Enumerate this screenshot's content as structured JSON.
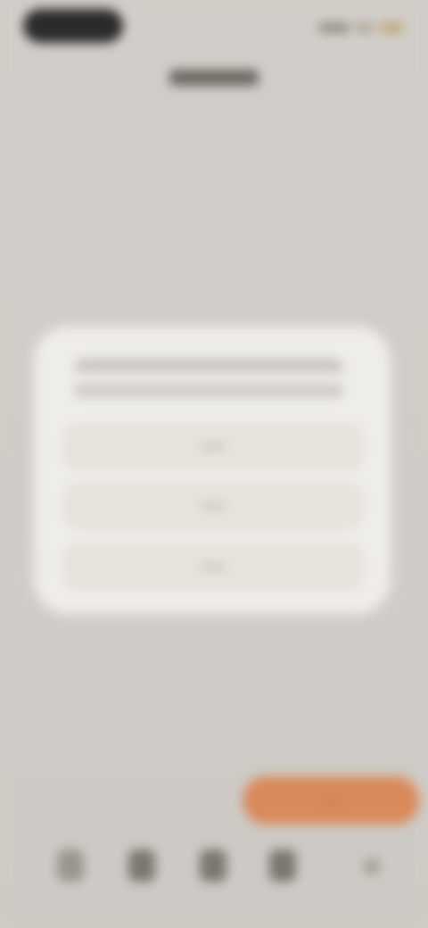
{
  "status_bar": {
    "icons": [
      "signal-icon",
      "wifi-icon",
      "battery-icon"
    ]
  },
  "header": {
    "title": ""
  },
  "dialog": {
    "message": "",
    "buttons": [
      {
        "label": ""
      },
      {
        "label": ""
      },
      {
        "label": ""
      }
    ]
  },
  "fab": {
    "label": ""
  },
  "bottom_nav": {
    "icons": [
      "home-icon",
      "tab-2-icon",
      "tab-3-icon",
      "tab-4-icon",
      "tab-5-icon"
    ]
  },
  "colors": {
    "background": "#cfcbc6",
    "dialog": "#efede8",
    "accent": "#d98a5a"
  }
}
